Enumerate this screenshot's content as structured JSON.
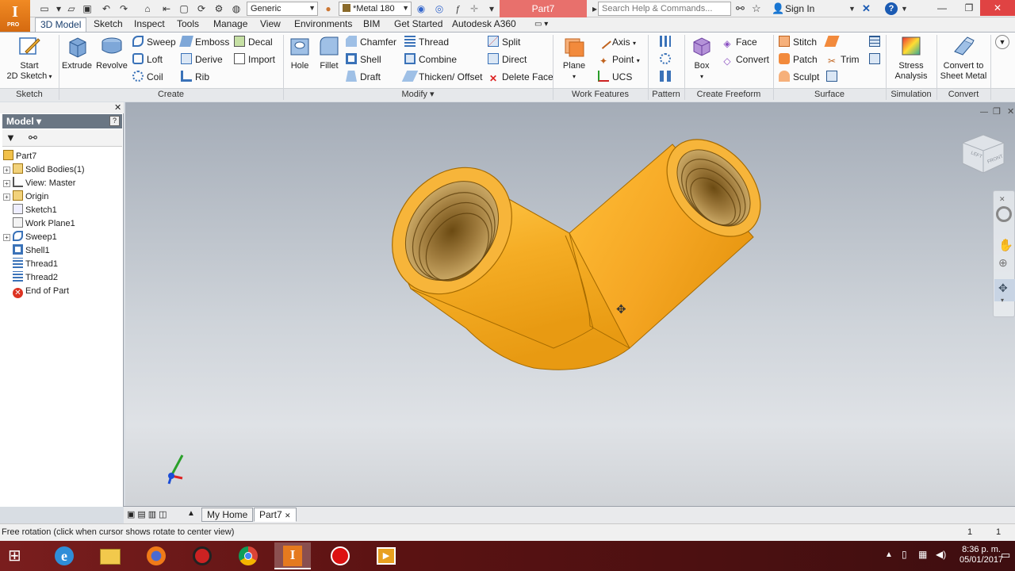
{
  "titlebar": {
    "style_combo": "Generic",
    "material_combo": "*Metal 180",
    "doc_title": "Part7",
    "search_placeholder": "Search Help & Commands...",
    "signin": "Sign In",
    "app_badge": "PRO"
  },
  "menu_tabs": [
    "3D Model",
    "Sketch",
    "Inspect",
    "Tools",
    "Manage",
    "View",
    "Environments",
    "BIM",
    "Get Started",
    "Autodesk A360"
  ],
  "ribbon": {
    "groups": [
      "Sketch",
      "Create",
      "Modify",
      "Work Features",
      "Pattern",
      "Create Freeform",
      "Surface",
      "Simulation",
      "Convert"
    ],
    "start_sketch": [
      "Start",
      "2D Sketch"
    ],
    "create": {
      "extrude": "Extrude",
      "revolve": "Revolve",
      "sweep": "Sweep",
      "loft": "Loft",
      "coil": "Coil",
      "emboss": "Emboss",
      "derive": "Derive",
      "rib": "Rib",
      "decal": "Decal",
      "import": "Import"
    },
    "modify": {
      "hole": "Hole",
      "fillet": "Fillet",
      "chamfer": "Chamfer",
      "shell": "Shell",
      "draft": "Draft",
      "thread": "Thread",
      "combine": "Combine",
      "thicken": "Thicken/ Offset",
      "split": "Split",
      "direct": "Direct",
      "delete_face": "Delete Face"
    },
    "work": {
      "plane": "Plane",
      "axis": "Axis",
      "point": "Point",
      "ucs": "UCS"
    },
    "freeform": {
      "box": "Box",
      "face": "Face",
      "convert": "Convert"
    },
    "surface": {
      "stitch": "Stitch",
      "patch": "Patch",
      "sculpt": "Sculpt",
      "trim": "Trim"
    },
    "simulation": [
      "Stress",
      "Analysis"
    ],
    "convert": [
      "Convert to",
      "Sheet Metal"
    ]
  },
  "browser": {
    "title": "Model",
    "help": "?",
    "tree": [
      "Part7",
      "Solid Bodies(1)",
      "View: Master",
      "Origin",
      "Sketch1",
      "Work Plane1",
      "Sweep1",
      "Shell1",
      "Thread1",
      "Thread2",
      "End of Part"
    ]
  },
  "viewcube": {
    "left": "LEFT",
    "front": "FRONT"
  },
  "doc_tabs": [
    "My Home",
    "Part7"
  ],
  "status": {
    "message": "Free rotation (click when cursor shows rotate to center view)",
    "count1": "1",
    "count2": "1"
  },
  "clock": {
    "time": "8:36 p. m.",
    "date": "05/01/2017"
  },
  "colors": {
    "part": "#f5a623",
    "accent": "#1a3f6e",
    "title_active": "#e8706c"
  }
}
